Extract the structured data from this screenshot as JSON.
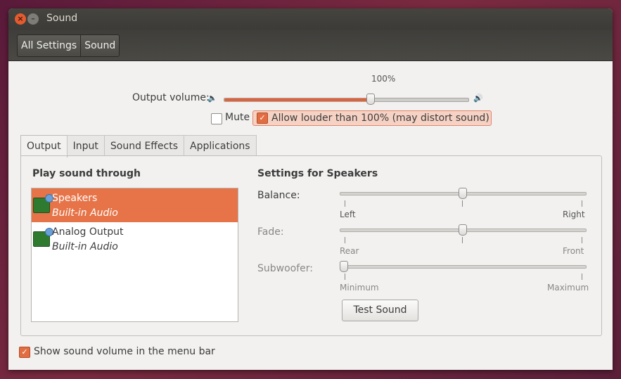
{
  "window": {
    "title": "Sound"
  },
  "breadcrumbs": [
    "All Settings",
    "Sound"
  ],
  "output_volume": {
    "label": "Output volume:",
    "percent_label": "100%",
    "level_fraction": 0.6
  },
  "mute": {
    "label": "Mute",
    "checked": false
  },
  "allow_louder": {
    "label": "Allow louder than 100% (may distort sound)",
    "checked": true
  },
  "tabs": [
    {
      "label": "Output",
      "active": true
    },
    {
      "label": "Input",
      "active": false
    },
    {
      "label": "Sound Effects",
      "active": false
    },
    {
      "label": "Applications",
      "active": false
    }
  ],
  "output": {
    "play_through_title": "Play sound through",
    "devices": [
      {
        "name": "Speakers",
        "sub": "Built-in Audio",
        "selected": true
      },
      {
        "name": "Analog Output",
        "sub": "Built-in Audio",
        "selected": false
      }
    ],
    "settings_title": "Settings for Speakers",
    "balance": {
      "label": "Balance:",
      "left": "Left",
      "right": "Right",
      "value": 0.5
    },
    "fade": {
      "label": "Fade:",
      "left": "Rear",
      "right": "Front",
      "value": 0.5
    },
    "subwoofer": {
      "label": "Subwoofer:",
      "left": "Minimum",
      "right": "Maximum",
      "value": 0.0
    },
    "test_button": "Test Sound"
  },
  "menu_bar_option": {
    "label": "Show sound volume in the menu bar",
    "checked": true
  },
  "colors": {
    "accent": "#e26d42",
    "selection": "#e67448",
    "titlebar": "#3c3b37"
  }
}
